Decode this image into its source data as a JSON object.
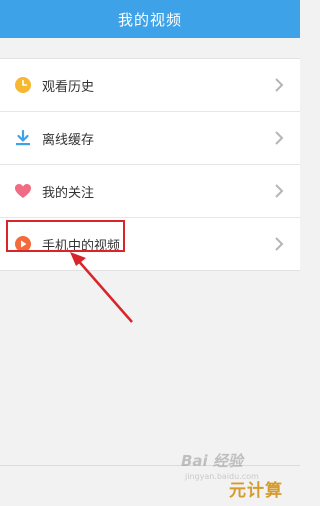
{
  "header": {
    "title": "我的视频"
  },
  "menu": {
    "items": [
      {
        "label": "观看历史",
        "icon": "clock-icon",
        "color": "#f5b82e"
      },
      {
        "label": "离线缓存",
        "icon": "download-icon",
        "color": "#3ea2e8"
      },
      {
        "label": "我的关注",
        "icon": "heart-icon",
        "color": "#f06b84"
      },
      {
        "label": "手机中的视频",
        "icon": "play-icon",
        "color": "#f26b3c"
      }
    ]
  },
  "colors": {
    "header_bg": "#3ea2e8",
    "highlight": "#d7252a"
  },
  "watermark": {
    "text": "Bai  经验",
    "sub": "jingyan.baidu.com"
  },
  "brand": {
    "text": "元计算"
  }
}
